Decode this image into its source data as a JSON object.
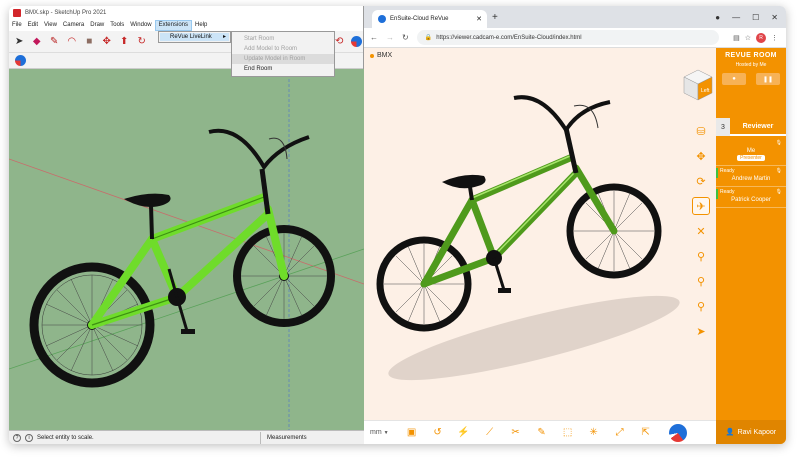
{
  "sketchup": {
    "title": "BMX.skp - SketchUp Pro 2021",
    "menu": [
      "File",
      "Edit",
      "View",
      "Camera",
      "Draw",
      "Tools",
      "Window",
      "Extensions",
      "Help"
    ],
    "active_menu": "Extensions",
    "extensions_menu": {
      "item": "ReVue LiveLink",
      "arrow": "▸"
    },
    "livelink_submenu": [
      "Start Room",
      "Add Model to Room",
      "Update Model in Room",
      "End Room"
    ],
    "status_text": "Select entity to scale.",
    "measurements_label": "Measurements"
  },
  "browser": {
    "tab_title": "EnSuite-Cloud ReVue",
    "url": "https://viewer.cadcam-e.com/EnSuite-Cloud/index.html",
    "profile_initial": "R"
  },
  "revue": {
    "model_name": "BMX",
    "unit": "mm",
    "cube_label": "Left",
    "room_panel": {
      "title": "REVUE ROOM",
      "hosted_by": "Hosted by Me",
      "participant_count": "3",
      "tab_label": "Reviewer",
      "participants": [
        {
          "status": "",
          "name": "Me",
          "role": "Presenter"
        },
        {
          "status": "Ready",
          "name": "Andrew Martin",
          "role": ""
        },
        {
          "status": "Ready",
          "name": "Patrick Cooper",
          "role": ""
        }
      ],
      "current_user": "Ravi Kapoor"
    }
  },
  "colors": {
    "accent": "#f39200",
    "viewport_green": "#8fb58b",
    "viewer_bg": "#fdf0e6",
    "bike_green": "#6fdc2a"
  }
}
